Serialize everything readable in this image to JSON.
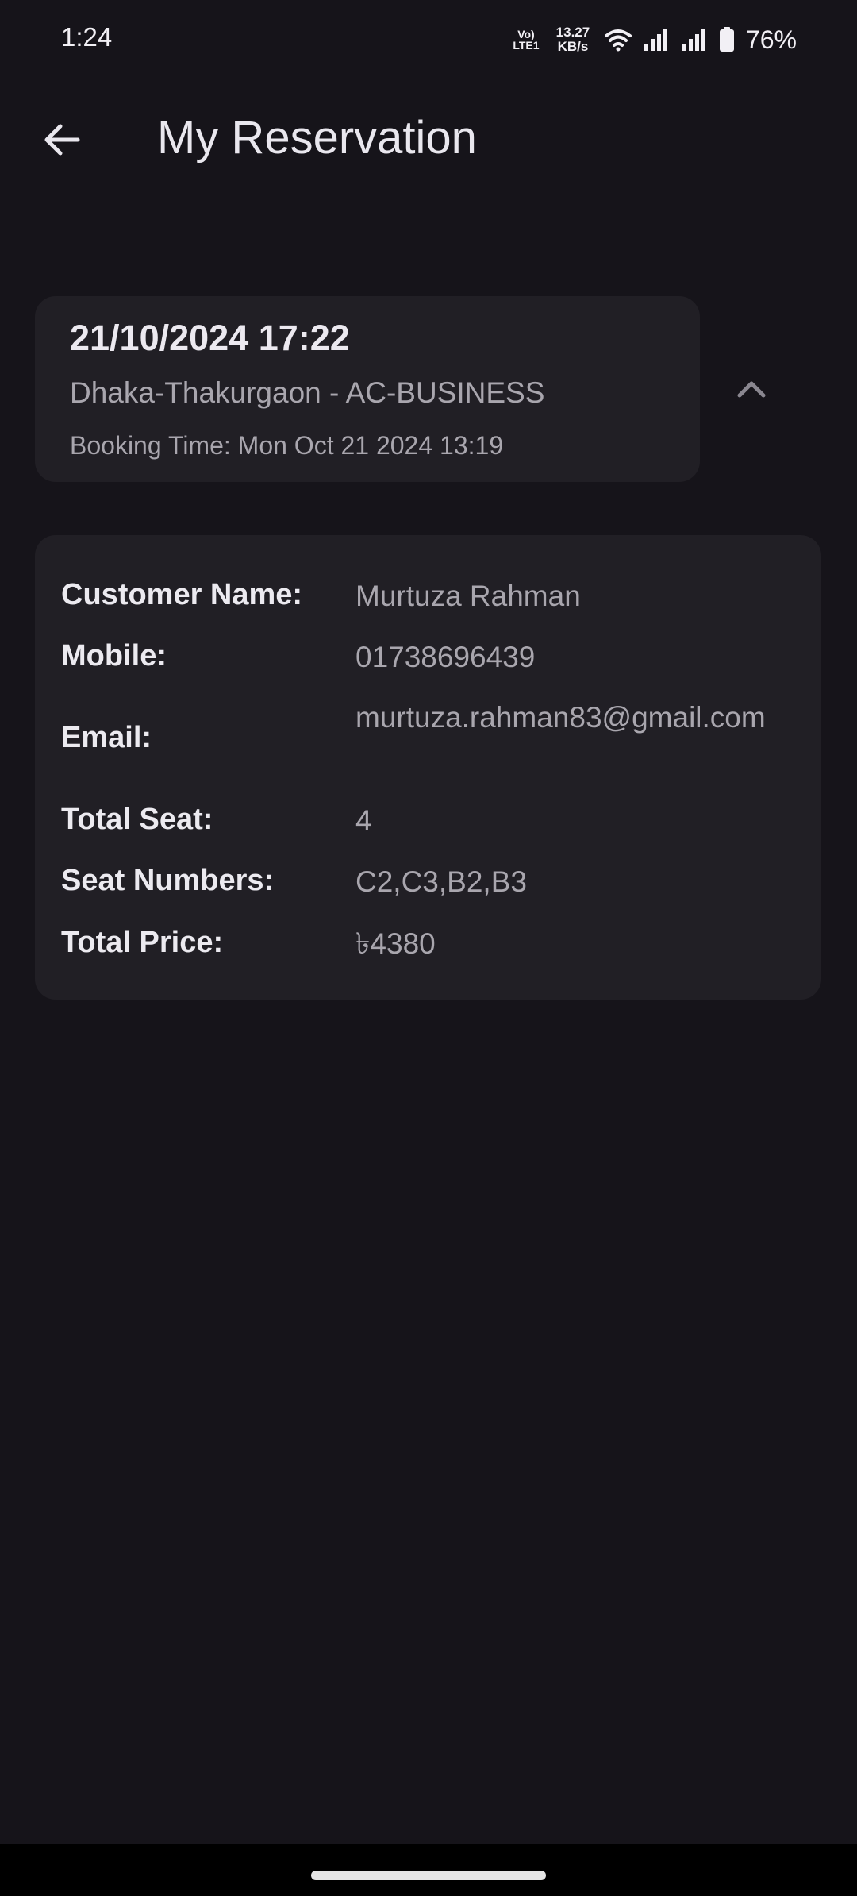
{
  "status_bar": {
    "time": "1:24",
    "volte_line1": "Vo)",
    "volte_line2": "LTE1",
    "net_speed_value": "13.27",
    "net_speed_unit": "KB/s",
    "battery_percent": "76%",
    "icons": [
      "wifi-icon",
      "signal-icon",
      "signal-icon",
      "battery-icon"
    ]
  },
  "app_bar": {
    "back_icon": "arrow-left-icon",
    "title": "My Reservation"
  },
  "reservation": {
    "datetime": "21/10/2024 17:22",
    "route": "Dhaka-Thakurgaon - AC-BUSINESS",
    "booking_time": "Booking Time: Mon Oct 21 2024 13:19",
    "toggle_icon": "chevron-up-icon",
    "details": [
      {
        "label": "Customer Name:",
        "value": "Murtuza Rahman"
      },
      {
        "label": "Mobile:",
        "value": "01738696439"
      },
      {
        "label": "Email:",
        "value": "murtuza.rahman83@gmail.com"
      },
      {
        "label": "Total Seat:",
        "value": "4"
      },
      {
        "label": "Seat Numbers:",
        "value": "C2,C3,B2,B3"
      },
      {
        "label": "Total Price:",
        "value": "৳4380"
      }
    ]
  },
  "colors": {
    "background": "#16141a",
    "card": "#211f25",
    "primary_text": "#ece9f0",
    "secondary_text": "#a9a6ae"
  }
}
